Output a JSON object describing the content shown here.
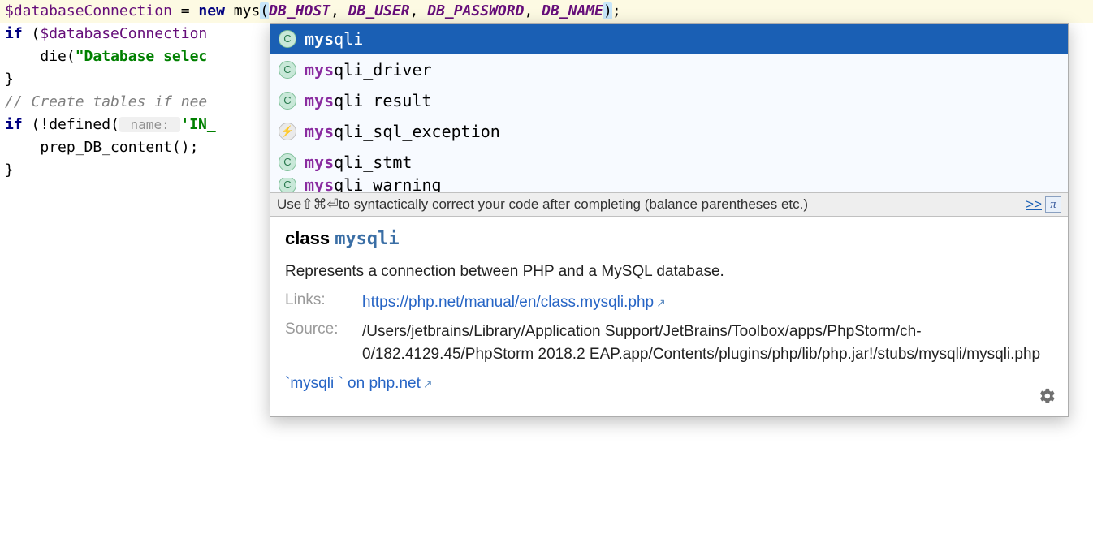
{
  "code": {
    "line1": {
      "var": "$databaseConnection",
      "eq": " = ",
      "kw": "new",
      "typed": " mys",
      "args_open": "(",
      "c1": "DB_HOST",
      "sep": ", ",
      "c2": "DB_USER",
      "c3": "DB_PASSWORD",
      "c4": "DB_NAME",
      "args_close": ")",
      "semi": ";"
    },
    "line2": {
      "kw": "if ",
      "open": "(",
      "var": "$databaseConnection"
    },
    "line3": {
      "indent": "    ",
      "fn": "die",
      "open": "(",
      "str": "\"Database selec"
    },
    "line4": "}",
    "line5": "",
    "line6": "// Create tables if nee",
    "line7": {
      "kw": "if ",
      "open": "(!",
      "fn": "defined",
      "p": "(",
      "hint": " name: ",
      "str": "'IN_"
    },
    "line8": {
      "indent": "    ",
      "fn": "prep_DB_content",
      "rest": "();"
    },
    "line9": "}"
  },
  "completion": {
    "items": [
      {
        "icon": "C",
        "prefix": "mys",
        "rest": "qli",
        "selected": true
      },
      {
        "icon": "C",
        "prefix": "mys",
        "rest": "qli_driver"
      },
      {
        "icon": "C",
        "prefix": "mys",
        "rest": "qli_result"
      },
      {
        "icon": "E",
        "prefix": "mys",
        "rest": "qli_sql_exception"
      },
      {
        "icon": "C",
        "prefix": "mys",
        "rest": "qli_stmt"
      },
      {
        "icon": "C",
        "prefix": "mys",
        "rest": "qli_warning"
      }
    ],
    "hint_pre": "Use ",
    "hint_keys": "⇧⌘⏎",
    "hint_post": " to syntactically correct your code after completing (balance parentheses etc.) ",
    "hint_link": ">>",
    "hint_pi": "π"
  },
  "doc": {
    "kw": "class",
    "cls": "mysqli",
    "desc": "Represents a connection between PHP and a MySQL database.",
    "links_label": "Links:",
    "link_url": "https://php.net/manual/en/class.mysqli.php",
    "source_label": "Source:",
    "source_path": "/Users/jetbrains/Library/Application Support/JetBrains/Toolbox/apps/PhpStorm/ch-0/182.4129.45/PhpStorm 2018.2 EAP.app/Contents/plugins/php/lib/php.jar!/stubs/mysqli/mysqli.php",
    "footer_link": "`mysqli ` on php.net"
  }
}
